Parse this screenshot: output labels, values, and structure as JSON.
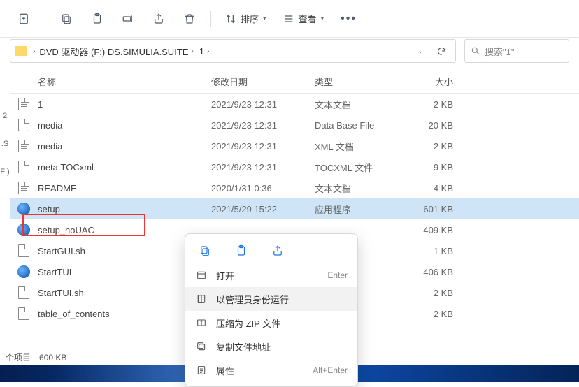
{
  "toolbar": {
    "sort_label": "排序",
    "view_label": "查看"
  },
  "breadcrumb": {
    "root": "DVD 驱动器 (F:) DS.SIMULIA.SUITE",
    "sub": "1"
  },
  "search": {
    "placeholder": "搜索\"1\""
  },
  "columns": {
    "name": "名称",
    "date": "修改日期",
    "type": "类型",
    "size": "大小"
  },
  "files": [
    {
      "name": "1",
      "date": "2021/9/23 12:31",
      "type": "文本文档",
      "size": "2 KB",
      "icon": "text"
    },
    {
      "name": "media",
      "date": "2021/9/23 12:31",
      "type": "Data Base File",
      "size": "20 KB",
      "icon": "db"
    },
    {
      "name": "media",
      "date": "2021/9/23 12:31",
      "type": "XML 文档",
      "size": "2 KB",
      "icon": "text"
    },
    {
      "name": "meta.TOCxml",
      "date": "2021/9/23 12:31",
      "type": "TOCXML 文件",
      "size": "9 KB",
      "icon": "blank"
    },
    {
      "name": "README",
      "date": "2020/1/31 0:36",
      "type": "文本文档",
      "size": "4 KB",
      "icon": "text"
    },
    {
      "name": "setup",
      "date": "2021/5/29 15:22",
      "type": "应用程序",
      "size": "601 KB",
      "icon": "app"
    },
    {
      "name": "setup_noUAC",
      "date": "",
      "type": "",
      "size": "409 KB",
      "icon": "app"
    },
    {
      "name": "StartGUI.sh",
      "date": "",
      "type": "",
      "size": "1 KB",
      "icon": "blank"
    },
    {
      "name": "StartTUI",
      "date": "",
      "type": "",
      "size": "406 KB",
      "icon": "app"
    },
    {
      "name": "StartTUI.sh",
      "date": "",
      "type": "",
      "size": "2 KB",
      "icon": "blank"
    },
    {
      "name": "table_of_contents",
      "date": "",
      "type": "",
      "size": "2 KB",
      "icon": "text"
    }
  ],
  "context_menu": {
    "open": "打开",
    "open_sc": "Enter",
    "run_admin": "以管理员身份运行",
    "zip": "压缩为 ZIP 文件",
    "copy_path": "复制文件地址",
    "properties": "属性",
    "properties_sc": "Alt+Enter"
  },
  "status": {
    "count": "个项目",
    "size": "600 KB"
  },
  "side": {
    "s1": "2",
    "s2": ".S",
    "s3": "F:)"
  }
}
